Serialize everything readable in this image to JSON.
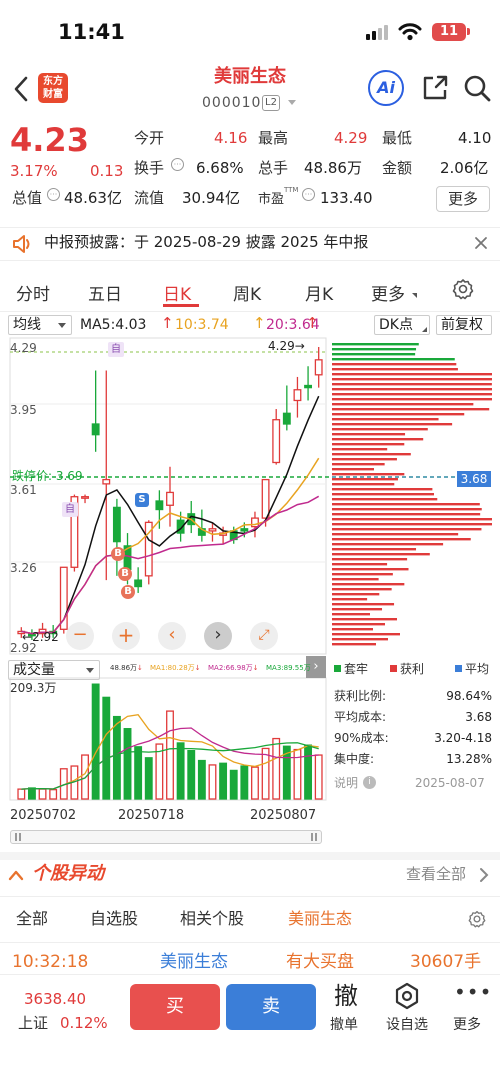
{
  "status": {
    "time": "11:41",
    "battery": "11"
  },
  "header": {
    "logo_line1": "东方",
    "logo_line2": "财富",
    "name": "美丽生态",
    "code": "000010",
    "level": "L2",
    "ai": "Ai"
  },
  "quote": {
    "price": "4.23",
    "pct": "3.17%",
    "change": "0.13",
    "open_label": "今开",
    "open": "4.16",
    "high_label": "最高",
    "high": "4.29",
    "low_label": "最低",
    "low": "4.10",
    "turnover_label": "换手",
    "turnover": "6.68%",
    "volume_label": "总手",
    "volume": "48.86万",
    "amount_label": "金额",
    "amount": "2.06亿",
    "mcap_label": "总值",
    "mcap": "48.63亿",
    "float_label": "流值",
    "float": "30.94亿",
    "pe_label": "市盈",
    "pe_sup": "TTM",
    "pe": "133.40",
    "more": "更多"
  },
  "notice": {
    "text": "中报预披露：于 2025-08-29 披露 2025 年中报"
  },
  "ktabs": [
    "分时",
    "五日",
    "日K",
    "周K",
    "月K",
    "更多"
  ],
  "chart_opts": {
    "ma_select": "均线",
    "ma5": "MA5:4.03",
    "ma10": "10:3.74",
    "ma20": "20:3.64",
    "dk": "DK点",
    "adjust": "前复权"
  },
  "chart_labels": {
    "y1": "4.29",
    "y2": "3.95",
    "y3": "3.61",
    "y4": "3.26",
    "y5": "2.92",
    "max_mark": "4.29",
    "min_mark": "2.92",
    "limit_up": "跌停价: 3.69",
    "right_price": "3.68",
    "mark_zi1": "自",
    "mark_zi2": "自",
    "mark_s": "S",
    "mark_b1": "B",
    "mark_b2": "B",
    "mark_b3": "B"
  },
  "volume": {
    "select": "成交量",
    "v": "48.86万",
    "ma1": "MA1:80.28万",
    "ma2": "MA2:66.98万",
    "ma3": "MA3:89.55万",
    "max": "209.3万",
    "d1": "20250702",
    "d2": "20250718",
    "d3": "20250807"
  },
  "chip": {
    "legend_trap": "套牢",
    "legend_profit": "获利",
    "legend_avg": "平均",
    "rows": [
      {
        "label": "获利比例:",
        "value": "98.64%"
      },
      {
        "label": "平均成本:",
        "value": "3.68"
      },
      {
        "label": "90%成本:",
        "value": "3.20-4.18"
      },
      {
        "label": "集中度:",
        "value": "13.28%"
      }
    ],
    "note_label": "说明",
    "note_date": "2025-08-07"
  },
  "colors": {
    "red": "#e03a3a",
    "green": "#19a83a",
    "blue": "#2b5fe0",
    "orange": "#e8732e"
  },
  "movement": {
    "title": "个股异动",
    "view_all": "查看全部"
  },
  "filters": [
    "全部",
    "自选股",
    "相关个股",
    "美丽生态"
  ],
  "feed": {
    "time": "10:32:18",
    "name": "美丽生态",
    "event": "有大买盘",
    "value": "30607手"
  },
  "bottom": {
    "index_value": "3638.40",
    "index_name": "上证",
    "index_pct": "0.12%",
    "buy": "买",
    "sell": "卖",
    "cancel_icon": "撤",
    "cancel": "撤单",
    "set_watch": "设自选",
    "more": "更多"
  },
  "chart_data": {
    "type": "candlestick",
    "ylim": [
      2.92,
      4.29
    ],
    "candles": [
      {
        "o": 2.95,
        "c": 2.96,
        "h": 2.98,
        "l": 2.93
      },
      {
        "o": 2.95,
        "c": 2.94,
        "h": 2.97,
        "l": 2.92
      },
      {
        "o": 2.95,
        "c": 2.97,
        "h": 3.0,
        "l": 2.93
      },
      {
        "o": 2.96,
        "c": 2.95,
        "h": 2.99,
        "l": 2.93
      },
      {
        "o": 2.97,
        "c": 3.26,
        "h": 3.26,
        "l": 2.95
      },
      {
        "o": 3.26,
        "c": 3.59,
        "h": 3.6,
        "l": 3.24
      },
      {
        "o": 3.59,
        "c": 3.59,
        "h": 3.6,
        "l": 3.56
      },
      {
        "o": 3.93,
        "c": 3.88,
        "h": 4.18,
        "l": 3.8
      },
      {
        "o": 3.65,
        "c": 3.67,
        "h": 4.18,
        "l": 3.2
      },
      {
        "o": 3.54,
        "c": 3.38,
        "h": 3.58,
        "l": 3.22
      },
      {
        "o": 3.36,
        "c": 3.25,
        "h": 3.42,
        "l": 3.18
      },
      {
        "o": 3.2,
        "c": 3.17,
        "h": 3.26,
        "l": 3.14
      },
      {
        "o": 3.22,
        "c": 3.47,
        "h": 3.48,
        "l": 3.18
      },
      {
        "o": 3.57,
        "c": 3.53,
        "h": 3.62,
        "l": 3.44
      },
      {
        "o": 3.55,
        "c": 3.61,
        "h": 3.73,
        "l": 3.45
      },
      {
        "o": 3.48,
        "c": 3.42,
        "h": 3.52,
        "l": 3.38
      },
      {
        "o": 3.51,
        "c": 3.46,
        "h": 3.57,
        "l": 3.42
      },
      {
        "o": 3.44,
        "c": 3.41,
        "h": 3.53,
        "l": 3.38
      },
      {
        "o": 3.43,
        "c": 3.44,
        "h": 3.47,
        "l": 3.38
      },
      {
        "o": 3.41,
        "c": 3.42,
        "h": 3.45,
        "l": 3.37
      },
      {
        "o": 3.43,
        "c": 3.39,
        "h": 3.45,
        "l": 3.37
      },
      {
        "o": 3.44,
        "c": 3.43,
        "h": 3.47,
        "l": 3.4
      },
      {
        "o": 3.45,
        "c": 3.49,
        "h": 3.52,
        "l": 3.4
      },
      {
        "o": 3.49,
        "c": 3.67,
        "h": 3.67,
        "l": 3.45
      },
      {
        "o": 3.75,
        "c": 3.95,
        "h": 4.0,
        "l": 3.74
      },
      {
        "o": 3.98,
        "c": 3.93,
        "h": 4.11,
        "l": 3.9
      },
      {
        "o": 4.04,
        "c": 4.09,
        "h": 4.15,
        "l": 3.96
      },
      {
        "o": 4.11,
        "c": 4.1,
        "h": 4.2,
        "l": 4.04
      },
      {
        "o": 4.16,
        "c": 4.23,
        "h": 4.29,
        "l": 4.1
      }
    ],
    "volumes": [
      {
        "v": 18,
        "up": true
      },
      {
        "v": 20,
        "up": false
      },
      {
        "v": 18,
        "up": true
      },
      {
        "v": 17,
        "up": true
      },
      {
        "v": 55,
        "up": true
      },
      {
        "v": 60,
        "up": true
      },
      {
        "v": 80,
        "up": true
      },
      {
        "v": 209,
        "up": false
      },
      {
        "v": 185,
        "up": false
      },
      {
        "v": 150,
        "up": false
      },
      {
        "v": 128,
        "up": false
      },
      {
        "v": 95,
        "up": false
      },
      {
        "v": 75,
        "up": false
      },
      {
        "v": 100,
        "up": true
      },
      {
        "v": 160,
        "up": true
      },
      {
        "v": 102,
        "up": false
      },
      {
        "v": 88,
        "up": false
      },
      {
        "v": 70,
        "up": false
      },
      {
        "v": 62,
        "up": true
      },
      {
        "v": 65,
        "up": false
      },
      {
        "v": 52,
        "up": false
      },
      {
        "v": 60,
        "up": false
      },
      {
        "v": 58,
        "up": true
      },
      {
        "v": 92,
        "up": true
      },
      {
        "v": 110,
        "up": true
      },
      {
        "v": 96,
        "up": false
      },
      {
        "v": 90,
        "up": true
      },
      {
        "v": 98,
        "up": false
      },
      {
        "v": 80,
        "up": true
      }
    ]
  }
}
